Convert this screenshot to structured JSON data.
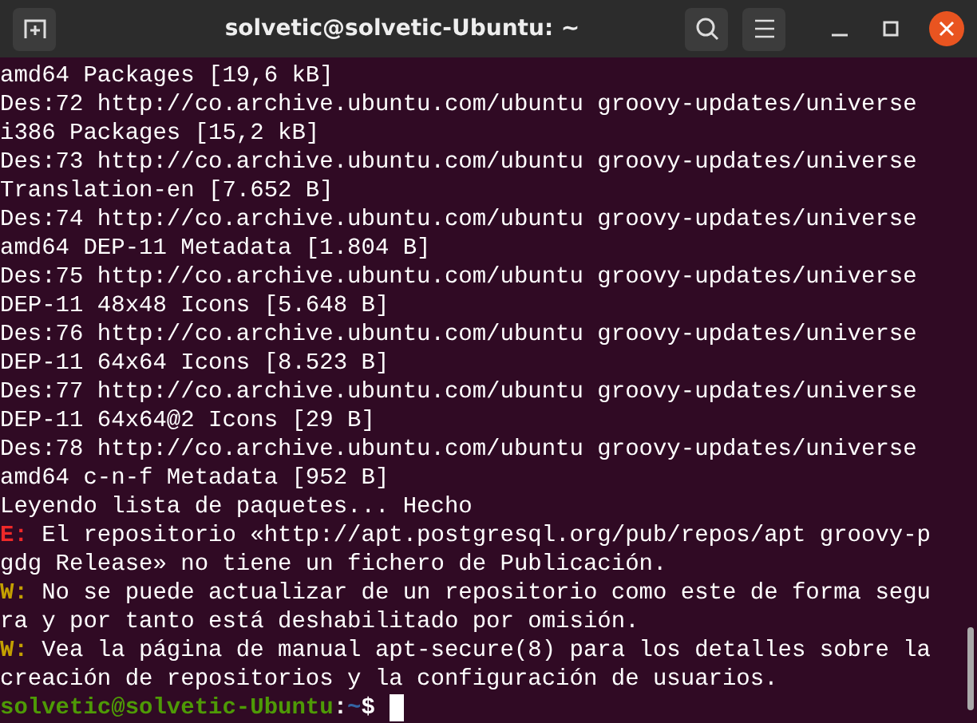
{
  "window": {
    "title": "solvetic@solvetic-Ubuntu: ~"
  },
  "terminal": {
    "lines": [
      {
        "text": "amd64 Packages [19,6 kB]"
      },
      {
        "text": "Des:72 http://co.archive.ubuntu.com/ubuntu groovy-updates/universe"
      },
      {
        "text": "i386 Packages [15,2 kB]"
      },
      {
        "text": "Des:73 http://co.archive.ubuntu.com/ubuntu groovy-updates/universe"
      },
      {
        "text": "Translation-en [7.652 B]"
      },
      {
        "text": "Des:74 http://co.archive.ubuntu.com/ubuntu groovy-updates/universe"
      },
      {
        "text": "amd64 DEP-11 Metadata [1.804 B]"
      },
      {
        "text": "Des:75 http://co.archive.ubuntu.com/ubuntu groovy-updates/universe"
      },
      {
        "text": "DEP-11 48x48 Icons [5.648 B]"
      },
      {
        "text": "Des:76 http://co.archive.ubuntu.com/ubuntu groovy-updates/universe"
      },
      {
        "text": "DEP-11 64x64 Icons [8.523 B]"
      },
      {
        "text": "Des:77 http://co.archive.ubuntu.com/ubuntu groovy-updates/universe"
      },
      {
        "text": "DEP-11 64x64@2 Icons [29 B]"
      },
      {
        "text": "Des:78 http://co.archive.ubuntu.com/ubuntu groovy-updates/universe"
      },
      {
        "text": "amd64 c-n-f Metadata [952 B]"
      },
      {
        "text": "Leyendo lista de paquetes... Hecho"
      },
      {
        "prefix": "E:",
        "kind": "error",
        "text": "El repositorio «http://apt.postgresql.org/pub/repos/apt groovy-p"
      },
      {
        "text": "gdg Release» no tiene un fichero de Publicación."
      },
      {
        "prefix": "W:",
        "kind": "warning",
        "text": "No se puede actualizar de un repositorio como este de forma segu"
      },
      {
        "text": "ra y por tanto está deshabilitado por omisión."
      },
      {
        "prefix": "W:",
        "kind": "warning",
        "text": "Vea la página de manual apt-secure(8) para los detalles sobre la"
      },
      {
        "text": "creación de repositorios y la configuración de usuarios."
      }
    ],
    "prompt": {
      "user_host": "solvetic@solvetic-Ubuntu",
      "separator": ":",
      "path": "~",
      "symbol": "$"
    }
  }
}
